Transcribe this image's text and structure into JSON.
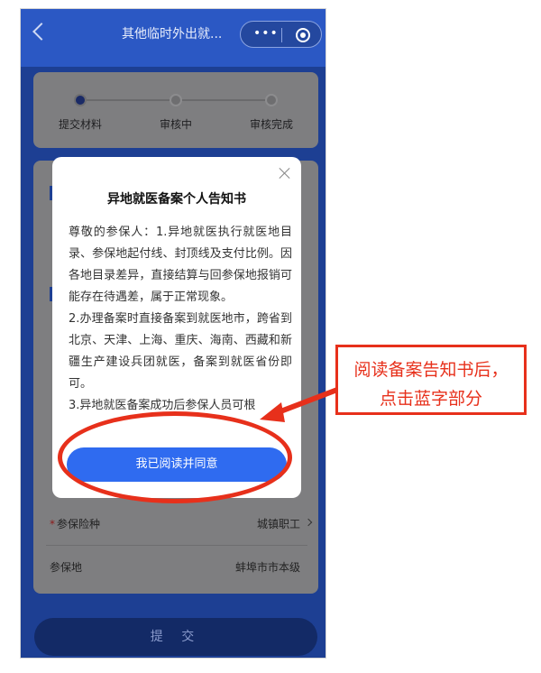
{
  "header": {
    "title": "其他临时外出就..."
  },
  "progress": {
    "steps": [
      {
        "label": "提交材料",
        "active": true
      },
      {
        "label": "审核中",
        "active": false
      },
      {
        "label": "审核完成",
        "active": false
      }
    ]
  },
  "form": {
    "insurance_type": {
      "label": "参保险种",
      "value": "城镇职工",
      "required": true
    },
    "insured_place": {
      "label": "参保地",
      "value": "蚌埠市市本级",
      "required": false
    }
  },
  "submit_label": "提 交",
  "modal": {
    "title": "异地就医备案个人告知书",
    "paragraphs": [
      "尊敬的参保人：1.异地就医执行就医地目录、参保地起付线、封顶线及支付比例。因各地目录差异，直接结算与回参保地报销可能存在待遇差，属于正常现象。",
      "2.办理备案时直接备案到就医地市，跨省到北京、天津、上海、重庆、海南、西藏和新疆生产建设兵团就医，备案到就医省份即可。",
      "3.异地就医备案成功后参保人员可根"
    ],
    "agree_label": "我已阅读并同意"
  },
  "annotation": {
    "line1": "阅读备案告知书后，",
    "line2": "点击蓝字部分",
    "color": "#e7301b"
  }
}
